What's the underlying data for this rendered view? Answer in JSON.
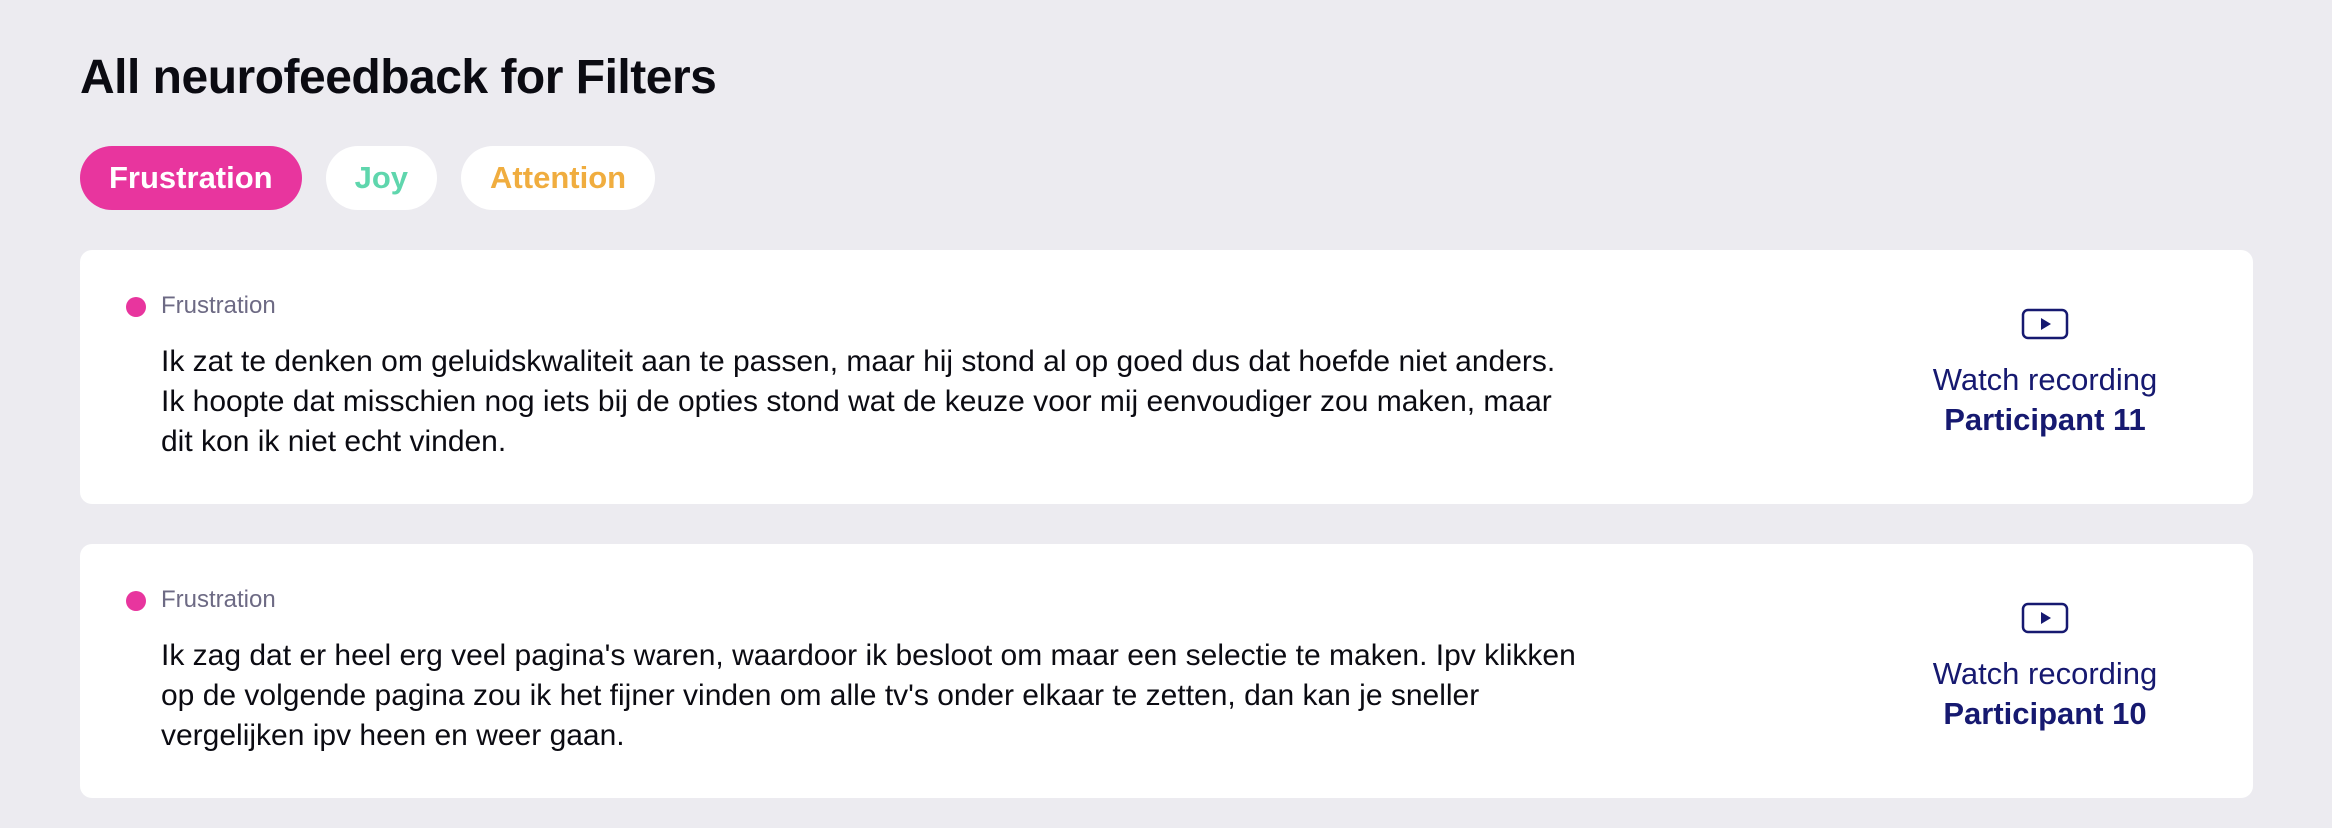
{
  "page": {
    "title": "All neurofeedback for Filters"
  },
  "filters": [
    {
      "label": "Frustration",
      "color": "#e8359e",
      "active": true
    },
    {
      "label": "Joy",
      "color": "#5fd6ad",
      "active": false
    },
    {
      "label": "Attention",
      "color": "#f0ad3f",
      "active": false
    }
  ],
  "colors": {
    "background": "#ecebf0",
    "card": "#ffffff",
    "link": "#161970",
    "muted_text": "#6d6a84"
  },
  "feedback": [
    {
      "emotion": "Frustration",
      "emotion_color": "#e8359e",
      "quote": "Ik zat te denken om geluidskwaliteit aan te passen, maar hij stond al op goed dus dat hoefde niet anders. Ik hoopte dat misschien nog iets bij de opties stond wat de keuze voor mij eenvoudiger zou maken, maar dit kon ik niet echt vinden.",
      "watch_label": "Watch recording",
      "participant": "Participant 11",
      "icon": "play-video-icon"
    },
    {
      "emotion": "Frustration",
      "emotion_color": "#e8359e",
      "quote": "Ik zag dat er heel erg veel pagina's waren, waardoor ik besloot om maar een selectie te maken.  Ipv klikken op de volgende pagina zou ik het fijner vinden om alle tv's onder elkaar te zetten, dan kan je sneller vergelijken ipv heen en weer gaan.",
      "watch_label": "Watch recording",
      "participant": "Participant 10",
      "icon": "play-video-icon"
    }
  ]
}
